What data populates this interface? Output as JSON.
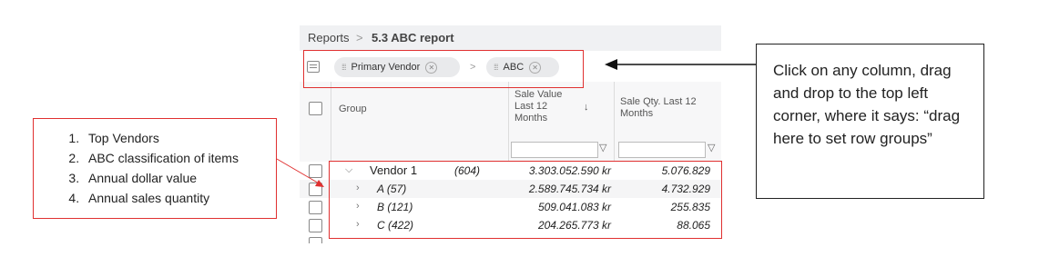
{
  "breadcrumb": {
    "root": "Reports",
    "separator": ">",
    "current": "5.3 ABC report"
  },
  "group_bar": {
    "chips": [
      {
        "label": "Primary Vendor"
      },
      {
        "label": "ABC"
      }
    ],
    "separator": ">"
  },
  "table": {
    "headers": {
      "group": "Group",
      "sale_value": "Sale Value Last 12 Months",
      "sale_qty": "Sale Qty. Last 12 Months",
      "sort_indicator": "↓"
    },
    "rows": [
      {
        "label": "Vendor 1",
        "count": "(604)",
        "value": "3.303.052.590 kr",
        "qty": "5.076.829",
        "expanded": true
      },
      {
        "label": "A (57)",
        "value": "2.589.745.734 kr",
        "qty": "4.732.929"
      },
      {
        "label": "B (121)",
        "value": "509.041.083 kr",
        "qty": "255.835"
      },
      {
        "label": "C (422)",
        "value": "204.265.773 kr",
        "qty": "88.065"
      }
    ]
  },
  "legend": {
    "items": [
      "Top Vendors",
      "ABC classification of items",
      "Annual dollar value",
      "Annual sales quantity"
    ]
  },
  "callout": {
    "text": "Click on any column, drag and drop to the top left corner, where it says: “drag here to set row groups”"
  },
  "colors": {
    "highlight": "#e03030",
    "header_bg": "#f7f7f8",
    "chip_bg": "#e9eaec"
  }
}
